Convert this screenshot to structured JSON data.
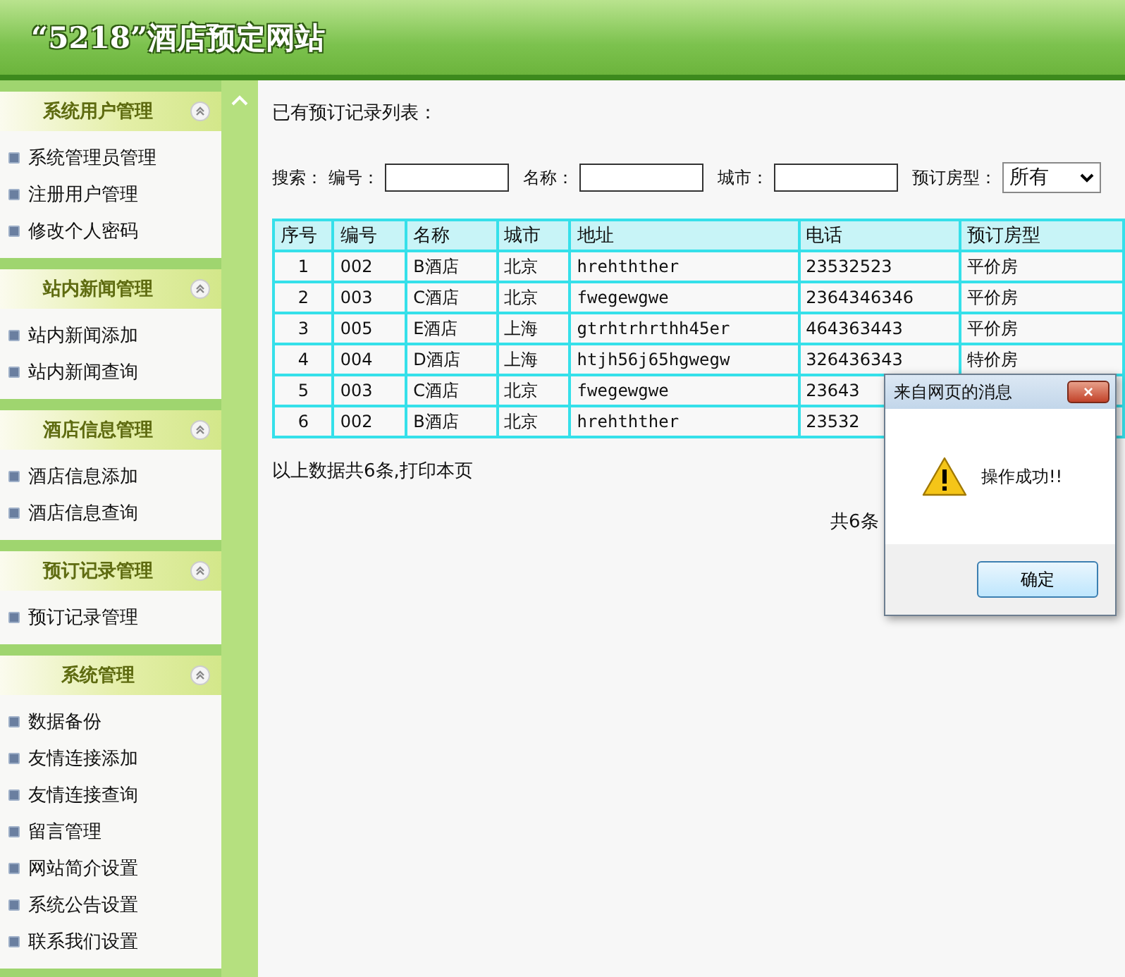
{
  "header": {
    "title": "“5218”酒店预定网站"
  },
  "sidebar": {
    "sections": [
      {
        "title": "系统用户管理",
        "expanded": true,
        "items": [
          "系统管理员管理",
          "注册用户管理",
          "修改个人密码"
        ]
      },
      {
        "title": "站内新闻管理",
        "expanded": true,
        "items": [
          "站内新闻添加",
          "站内新闻查询"
        ]
      },
      {
        "title": "酒店信息管理",
        "expanded": true,
        "items": [
          "酒店信息添加",
          "酒店信息查询"
        ]
      },
      {
        "title": "预订记录管理",
        "expanded": true,
        "items": [
          "预订记录管理"
        ]
      },
      {
        "title": "系统管理",
        "expanded": true,
        "items": [
          "数据备份",
          "友情连接添加",
          "友情连接查询",
          "留言管理",
          "网站简介设置",
          "系统公告设置",
          "联系我们设置"
        ]
      }
    ]
  },
  "main": {
    "heading": "已有预订记录列表：",
    "search": {
      "label": "搜索：",
      "fields": [
        {
          "label": "编号："
        },
        {
          "label": "名称："
        },
        {
          "label": "城市："
        }
      ],
      "select": {
        "label": "预订房型：",
        "value": "所有"
      }
    },
    "table": {
      "columns": [
        "序号",
        "编号",
        "名称",
        "城市",
        "地址",
        "电话",
        "预订房型"
      ],
      "rows": [
        [
          "1",
          "002",
          "B酒店",
          "北京",
          "hrehthther",
          "23532523",
          "平价房"
        ],
        [
          "2",
          "003",
          "C酒店",
          "北京",
          "fwegewgwe",
          "2364346346",
          "平价房"
        ],
        [
          "3",
          "005",
          "E酒店",
          "上海",
          "gtrhtrhrthh45er",
          "464363443",
          "平价房"
        ],
        [
          "4",
          "004",
          "D酒店",
          "上海",
          "htjh56j65hgwegw",
          "326436343",
          "特价房"
        ],
        [
          "5",
          "003",
          "C酒店",
          "北京",
          "fwegewgwe",
          "23643",
          ""
        ],
        [
          "6",
          "002",
          "B酒店",
          "北京",
          "hrehthther",
          "23532",
          ""
        ]
      ]
    },
    "summary": "以上数据共6条,打印本页",
    "pager": {
      "left": "共6条"
    }
  },
  "dialog": {
    "title": "来自网页的消息",
    "close": "×",
    "message": "操作成功!!",
    "button": "确定"
  }
}
